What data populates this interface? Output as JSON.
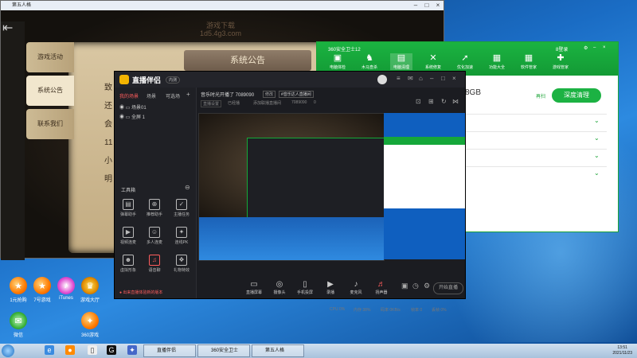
{
  "game_window": {
    "title": "第五人格",
    "watermark": "游戏下载\n1d5.4g3.com",
    "tabs": [
      "游戏活动",
      "系统公告",
      "联系我们"
    ],
    "banner": "系统公告",
    "fragments": [
      "致",
      "还",
      "会",
      "11",
      "小",
      "明"
    ]
  },
  "w360": {
    "title": "360安全卫士12",
    "user": "8登录",
    "nav": [
      "电脑体检",
      "木马查杀",
      "电脑清理",
      "系统修复",
      "优化加速",
      "功能大全",
      "软件管家",
      "游戏管家"
    ],
    "size_value": "8GB",
    "small_link": "再扫",
    "primary_button": "深度清理"
  },
  "zb": {
    "logo": "直播伴侣",
    "badge": "内测",
    "sidebar_tabs": [
      "我的场景",
      "场景",
      "可选场"
    ],
    "scenes": [
      "场景01",
      "全屏 1"
    ],
    "tools_label": "工具箱",
    "tools": [
      "弹幕助手",
      "推荐助手",
      "主播任务",
      "视频连麦",
      "多人连麦",
      "连线PK",
      "虚拟形象",
      "语音聊",
      "礼物特效"
    ],
    "live_title": "音乐时光开播了 7089090",
    "live_tag": "修改",
    "room_tag": "#音乐达人直播间",
    "sub_items": [
      "直播设置",
      "已经播",
      "添加联播直播间",
      "7089090",
      "0"
    ],
    "bottom_buttons": [
      "直播屏幕",
      "摄像头",
      "手机投屏",
      "录播",
      "麦克风",
      "扬声器"
    ],
    "start_button": "开始直播",
    "notice": "出来直播体验新的版本",
    "stats": [
      "CPU 0%",
      "内存 38%",
      "码率 0KB/s",
      "帧率 0",
      "丢帧 0%"
    ]
  },
  "desktop_icons": [
    "1元抢购",
    "7号游戏",
    "iTunes",
    "游戏大厅",
    "微信",
    "360游戏"
  ],
  "taskbar": {
    "items": [
      "直播伴侣",
      "360安全卫士",
      "第五人格"
    ],
    "time": "13:51",
    "date": "2021/11/23"
  }
}
